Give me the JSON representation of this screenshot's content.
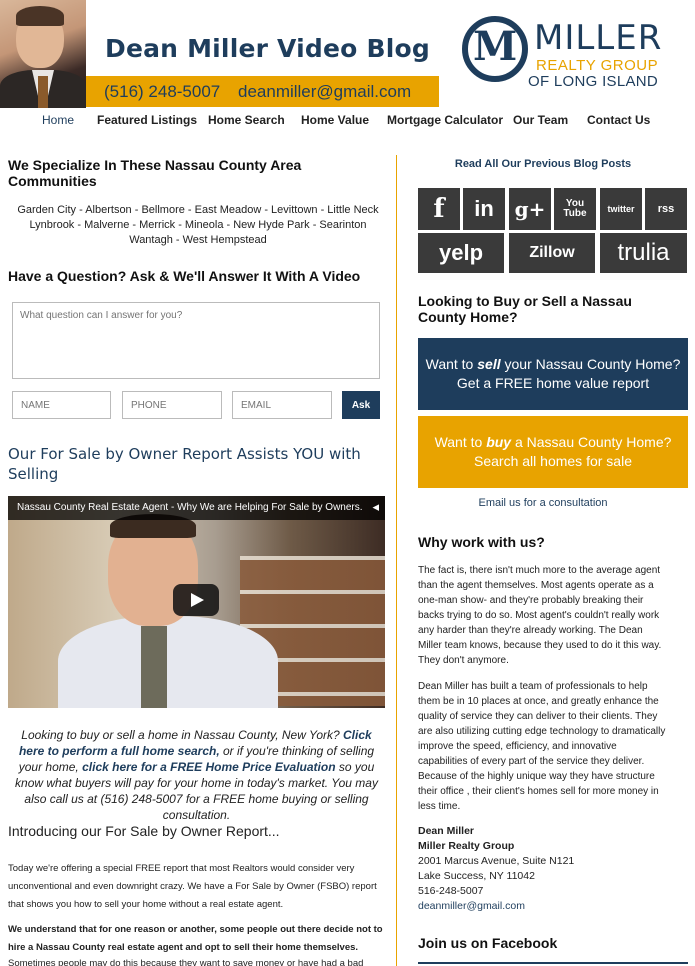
{
  "header": {
    "blog_title": "Dean Miller Video Blog",
    "phone": "(516) 248-5007",
    "email": "deanmiller@gmail.com",
    "logo": {
      "line1": "MILLER",
      "line2": "REALTY GROUP",
      "line3": "OF LONG ISLAND"
    }
  },
  "nav": {
    "items": [
      "Home",
      "Featured Listings",
      "Home Search",
      "Home Value",
      "Mortgage Calculator",
      "Our Team",
      "Contact Us"
    ],
    "active": "Home"
  },
  "left": {
    "communities_heading": "We Specialize In These Nassau County Area Communities",
    "communities_line1": "Garden City - Albertson - Bellmore - East Meadow - Levittown - Little Neck",
    "communities_line2": "Lynbrook - Malverne - Merrick - Mineola - New Hyde Park - Searinton",
    "communities_line3": "Wantagh - West Hempstead",
    "ask_heading": "Have a Question? Ask & We'll Answer It With A Video",
    "question_placeholder": "What question can I answer for you?",
    "name_placeholder": "NAME",
    "phone_placeholder": "PHONE",
    "email_placeholder": "EMAIL",
    "ask_button": "Ask",
    "fsbo_heading": "Our For Sale by Owner Report Assists YOU with Selling",
    "video_title": "Nassau County Real Estate Agent - Why We are Helping For Sale by Owners...",
    "promo_part1": "Looking to buy or sell a home in Nassau County, New York? ",
    "promo_link1": "Click here to perform a full home search,",
    "promo_part2": " or if you're thinking of selling your home, ",
    "promo_link2": "click here for a FREE Home Price Evaluation",
    "promo_part3": " so you know what buyers will pay for your home in today's market. You may also call us at (516) 248-5007 for a FREE home buying or selling consultation.",
    "intro_heading": "Introducing our For Sale by Owner Report...",
    "para1": "Today we're offering a special FREE report that most Realtors would consider very unconventional and even downright crazy. We have a For Sale by Owner (FSBO) report that shows you how to sell your home without a real estate agent.",
    "para2": "We understand that for one reason or another, some people out there decide not to hire a Nassau County real estate agent and opt to sell their home themselves.",
    "para3": "Sometimes people may do this because they want to save money or have had a bad"
  },
  "right": {
    "read_all": "Read All Our Previous Blog Posts",
    "social": [
      "f",
      "in",
      "g+",
      "You Tube",
      "twitter",
      "rss",
      "yelp",
      "Zillow",
      "trulia"
    ],
    "buy_sell_heading": "Looking to Buy or Sell a Nassau County Home?",
    "sell_line1_pre": "Want to ",
    "sell_line1_em": "sell",
    "sell_line1_post": " your Nassau County Home?",
    "sell_line2": "Get a FREE home value report",
    "buy_line1_pre": "Want to ",
    "buy_line1_em": "buy",
    "buy_line1_post": " a Nassau County Home?",
    "buy_line2": "Search all homes for sale",
    "email_consult": "Email us for a consultation",
    "why_heading": "Why work with us?",
    "why_para1": "The fact is, there isn't much more to the average agent than the agent themselves. Most agents operate as a one-man show- and they're probably breaking their backs trying to do so. Most agent's couldn't really work any harder than they're already working. The Dean Miller team knows, because they used to do it this way. They don't anymore.",
    "why_para2": "Dean Miller has built a team of professionals to help them be in 10 places at once, and greatly enhance the quality of service they can deliver to their clients. They are also utilizing cutting edge technology to dramatically improve the speed, efficiency, and innovative capabilities of every part of the service they deliver. Because of the highly unique way they have structure their office , their client's homes sell for more money in less time.",
    "contact_name": "Dean Miller",
    "contact_company": "Miller Realty Group",
    "contact_address1": "2001 Marcus Avenue, Suite N121",
    "contact_address2": "Lake Success, NY 11042",
    "contact_phone": "516-248-5007",
    "contact_email": "deanmiller@gmail.com",
    "facebook_heading": "Join us on Facebook"
  }
}
